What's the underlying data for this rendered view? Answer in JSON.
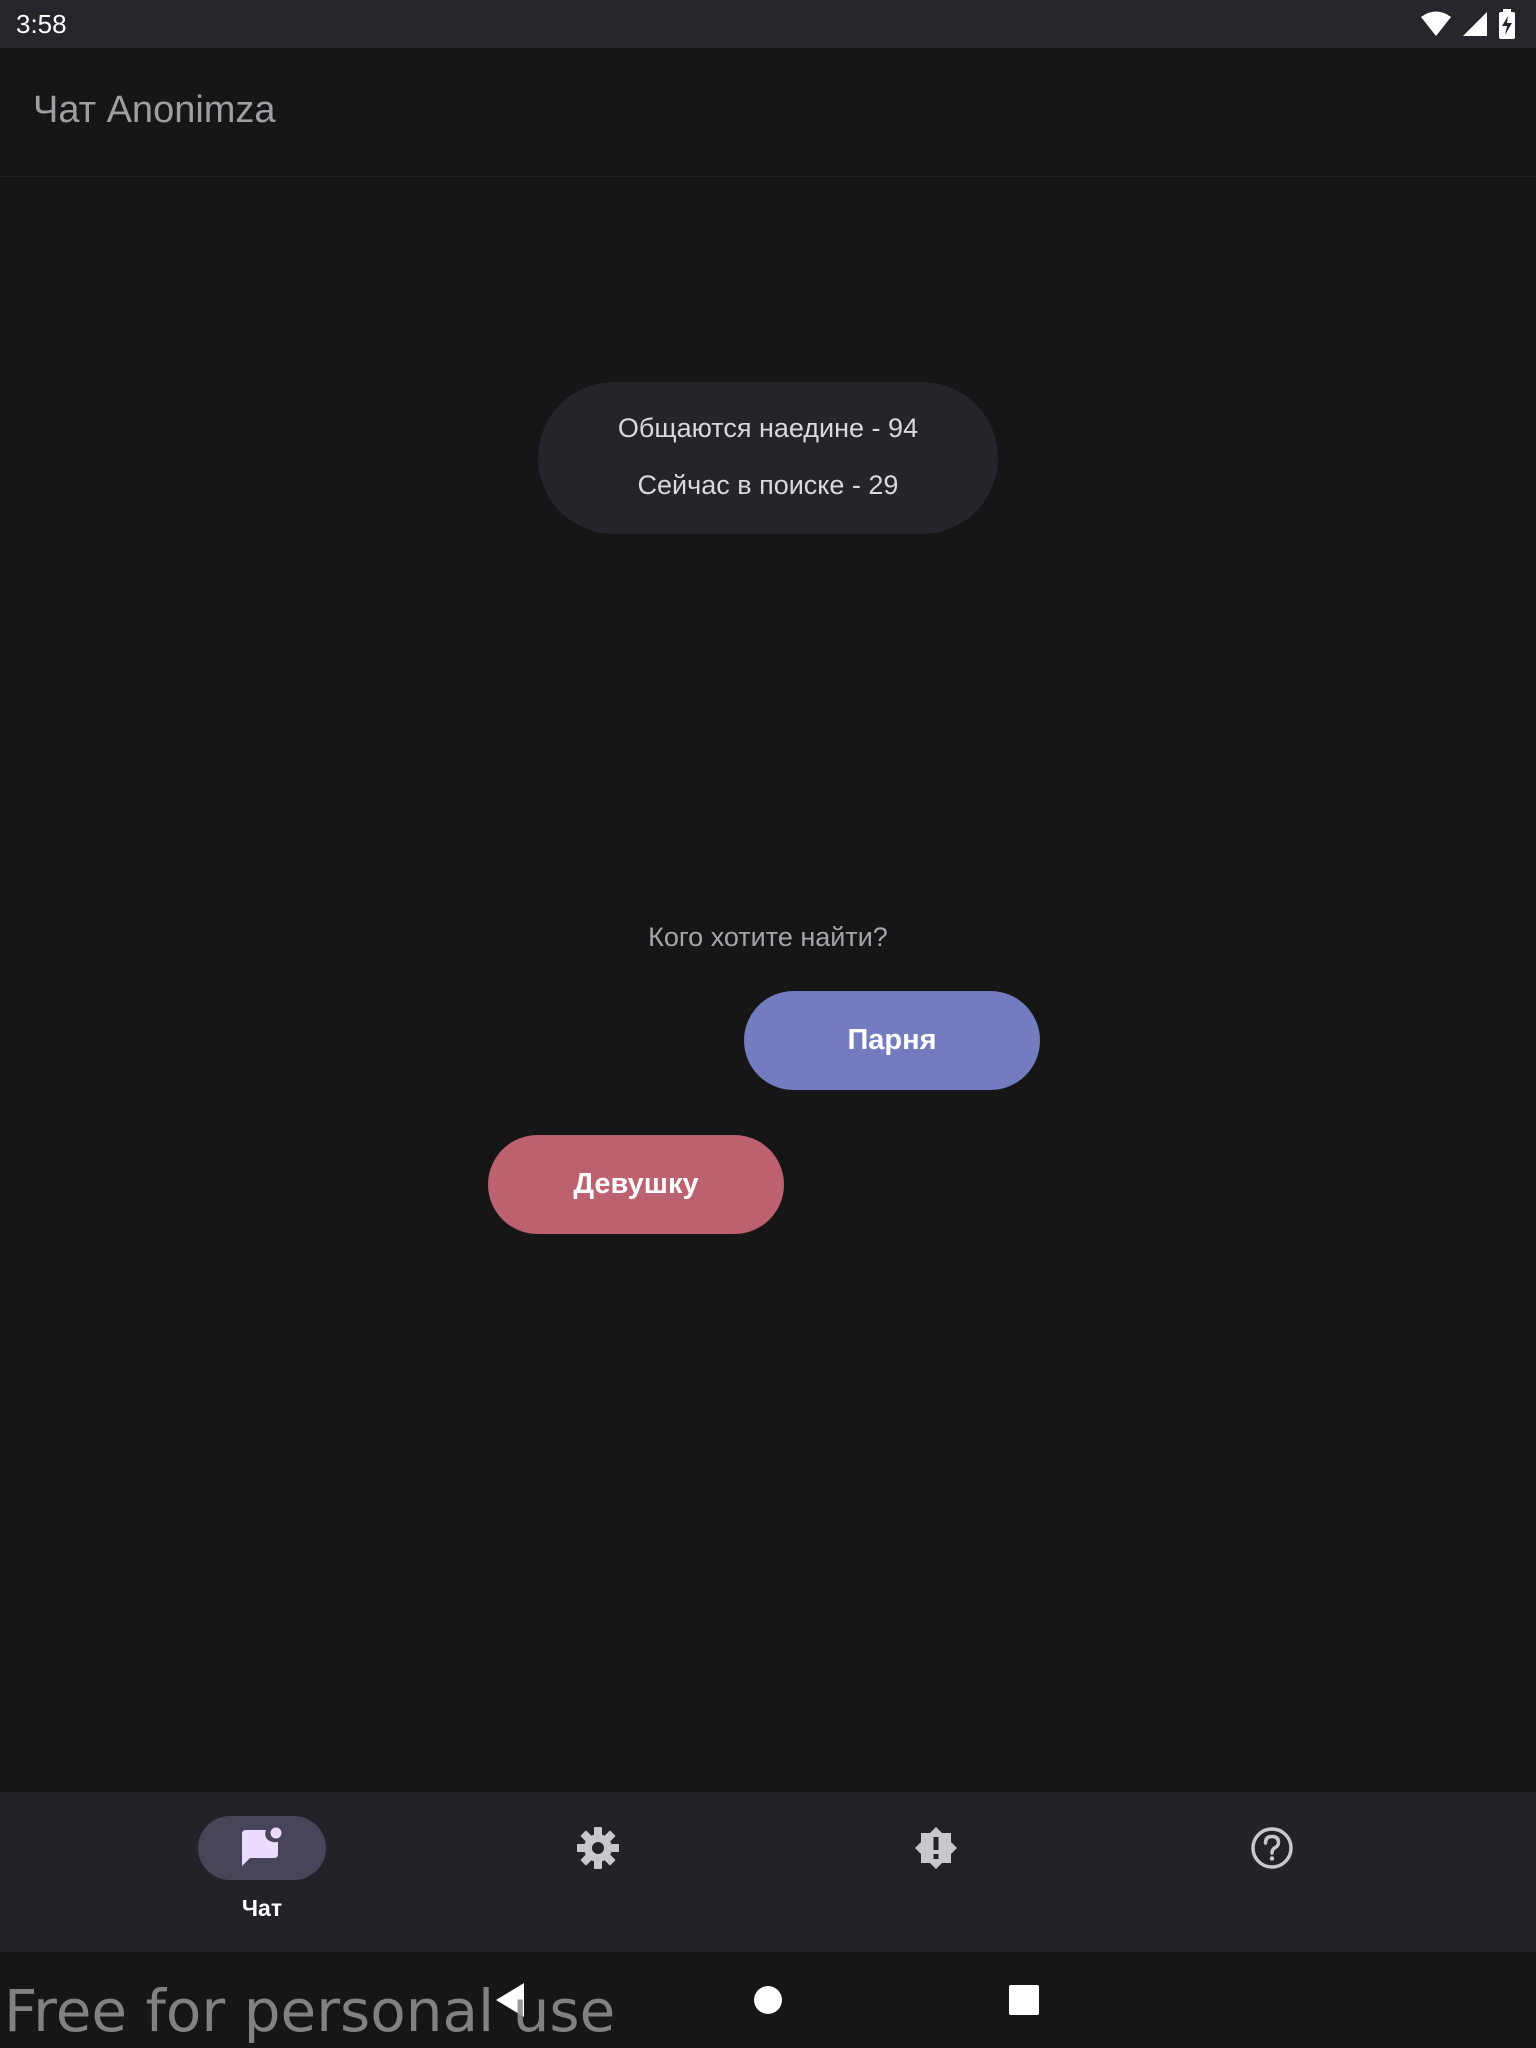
{
  "status_bar": {
    "time": "3:58",
    "icons": [
      "wifi-icon",
      "signal-icon",
      "battery-charging-icon"
    ]
  },
  "app_bar": {
    "title": "Чат Anonimza"
  },
  "stats": {
    "online_pairs": "Общаются наедине - 94",
    "searching": "Сейчас в поиске - 29"
  },
  "search": {
    "question": "Кого хотите найти?",
    "guy_button": "Парня",
    "girl_button": "Девушку"
  },
  "bottom_nav": {
    "items": [
      {
        "label": "Чат",
        "icon": "chat-icon",
        "selected": true
      },
      {
        "label": "",
        "icon": "gear-icon",
        "selected": false
      },
      {
        "label": "",
        "icon": "report-icon",
        "selected": false
      },
      {
        "label": "",
        "icon": "help-icon",
        "selected": false
      }
    ]
  },
  "system_nav": {
    "icons": [
      "back-icon",
      "home-icon",
      "recents-icon"
    ]
  },
  "watermark": "Free for personal use",
  "colors": {
    "background": "#161617",
    "surface": "#25242a",
    "guy_button": "#727cbf",
    "girl_button": "#bc6170",
    "nav_selected": "#48455a"
  }
}
